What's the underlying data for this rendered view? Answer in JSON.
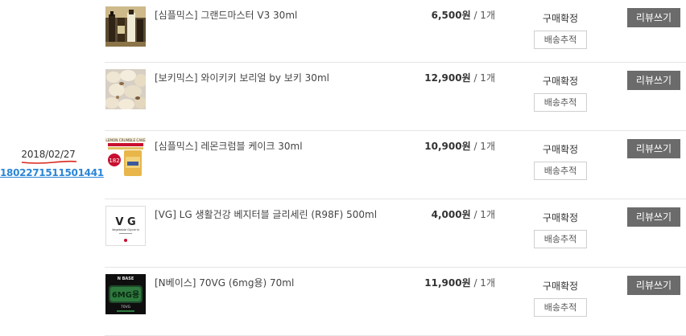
{
  "order": {
    "date": "2018/02/27",
    "number": "1802271511501441"
  },
  "items": [
    {
      "name": "[심플믹스] 그랜드마스터 V3 30ml",
      "price": "6,500원",
      "qty": "/ 1개",
      "status": "구매확정",
      "track_label": "배송추적",
      "review_label": "리뷰쓰기",
      "thumb_icon": "bottle-product-image"
    },
    {
      "name": "[보키믹스] 와이키키 보리얼 by 보키 30ml",
      "price": "12,900원",
      "qty": "/ 1개",
      "status": "구매확정",
      "track_label": "배송추적",
      "review_label": "리뷰쓰기",
      "thumb_icon": "cereal-product-image"
    },
    {
      "name": "[심플믹스] 레몬크럼블 케이크 30ml",
      "price": "10,900원",
      "qty": "/ 1개",
      "status": "구매확정",
      "track_label": "배송추적",
      "review_label": "리뷰쓰기",
      "thumb_icon": "lemon-cake-product-image",
      "thumb_text": "LEMON CRUMBLE CAKE"
    },
    {
      "name": "[VG] LG 생활건강 베지터블 글리세린 (R98F) 500ml",
      "price": "4,000원",
      "qty": "/ 1개",
      "status": "구매확정",
      "track_label": "배송추적",
      "review_label": "리뷰쓰기",
      "thumb_icon": "vg-product-image",
      "thumb_text": "V G",
      "thumb_subtext": "Vegetable Glycerin"
    },
    {
      "name": "[N베이스] 70VG (6mg용) 70ml",
      "price": "11,900원",
      "qty": "/ 1개",
      "status": "구매확정",
      "track_label": "배송추적",
      "review_label": "리뷰쓰기",
      "thumb_icon": "nbase-product-image",
      "thumb_text": "N BASE",
      "thumb_text2": "6MG용",
      "thumb_text3": "70VG"
    }
  ],
  "colors": {
    "link": "#2b86d6",
    "review_button": "#6b6b6b",
    "divider": "#e5e5e5",
    "date_underline": "#d9261c"
  }
}
